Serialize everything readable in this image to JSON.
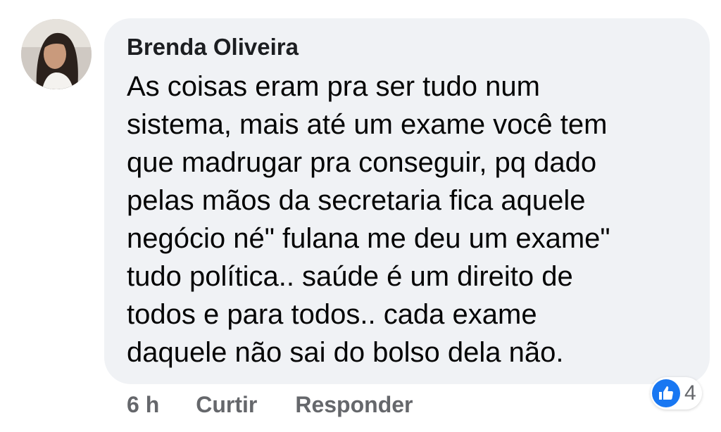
{
  "comment": {
    "author": "Brenda Oliveira",
    "text": "As coisas eram pra ser tudo num\nsistema, mais até um exame você tem\nque madrugar pra conseguir, pq dado\npelas mãos da secretaria fica aquele\nnegócio né\" fulana me deu um exame\"\ntudo política.. saúde é um direito de\ntodos e para todos.. cada exame\ndaquele não sai do bolso dela não.",
    "time": "6 h",
    "like_label": "Curtir",
    "reply_label": "Responder",
    "reaction_count": "4",
    "reaction_icon": "thumbs-up-icon"
  },
  "colors": {
    "bubble": "#f0f2f5",
    "action_text": "#65676b",
    "like_blue": "#1877f2"
  }
}
